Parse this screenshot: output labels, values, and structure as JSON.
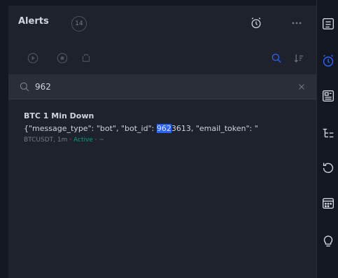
{
  "header": {
    "title": "Alerts",
    "count": "14"
  },
  "search": {
    "value": "962",
    "placeholder": ""
  },
  "alerts": [
    {
      "name": "BTC 1 Min Down",
      "message_pre": "{\"message_type\": \"bot\", \"bot_id\": ",
      "message_match": "962",
      "message_post": "3613, \"email_token\": \"",
      "symbol": "BTCUSDT, 1m",
      "sep1": "·",
      "status": "Active",
      "sep2": "·",
      "condition": "~"
    }
  ],
  "colors": {
    "accent": "#2962ff",
    "active": "#089981",
    "panel_bg": "#1e222d",
    "page_bg": "#131722"
  },
  "icons": {
    "header": [
      "alarm-clock-icon",
      "more-icon"
    ],
    "toolbar": [
      "play-icon",
      "stop-icon",
      "restart-icon",
      "search-icon",
      "sort-icon"
    ],
    "right_bar": [
      "watchlist-icon",
      "alerts-icon",
      "news-icon",
      "object-tree-icon",
      "history-icon",
      "calendar-icon",
      "ideas-icon"
    ]
  }
}
